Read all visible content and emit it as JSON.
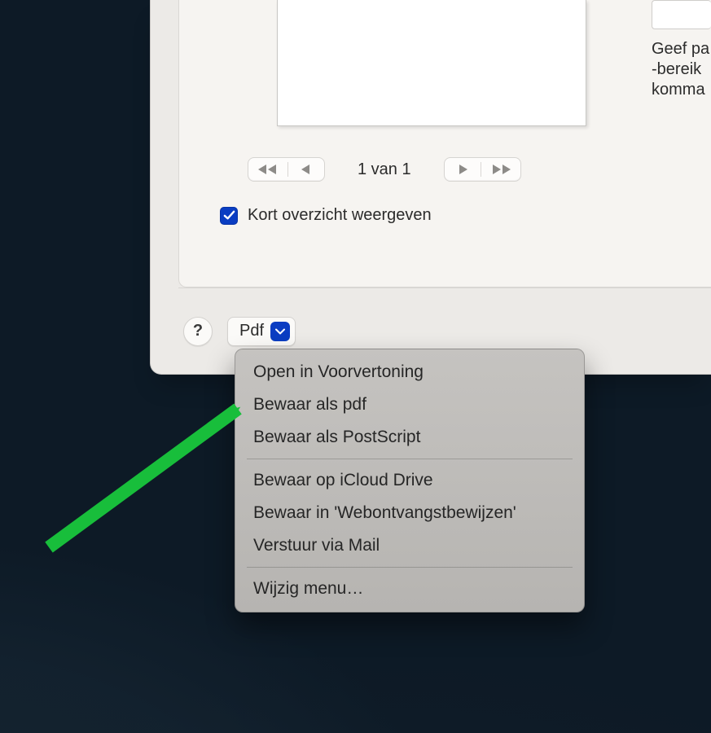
{
  "pager": {
    "label": "1 van 1"
  },
  "short_overview": {
    "label": "Kort overzicht weergeven",
    "checked": true
  },
  "right_text": "Geef pa\n-bereik\nkomma",
  "help": {
    "label": "?"
  },
  "pdf_button": {
    "label": "Pdf"
  },
  "menu": {
    "group1": [
      "Open in Voorvertoning",
      "Bewaar als pdf",
      "Bewaar als PostScript"
    ],
    "group2": [
      "Bewaar op iCloud Drive",
      "Bewaar in 'Webontvangstbewijzen'",
      "Verstuur via Mail"
    ],
    "group3": [
      "Wijzig menu…"
    ]
  },
  "colors": {
    "accent": "#0a3dc2",
    "arrow": "#18be3b"
  }
}
